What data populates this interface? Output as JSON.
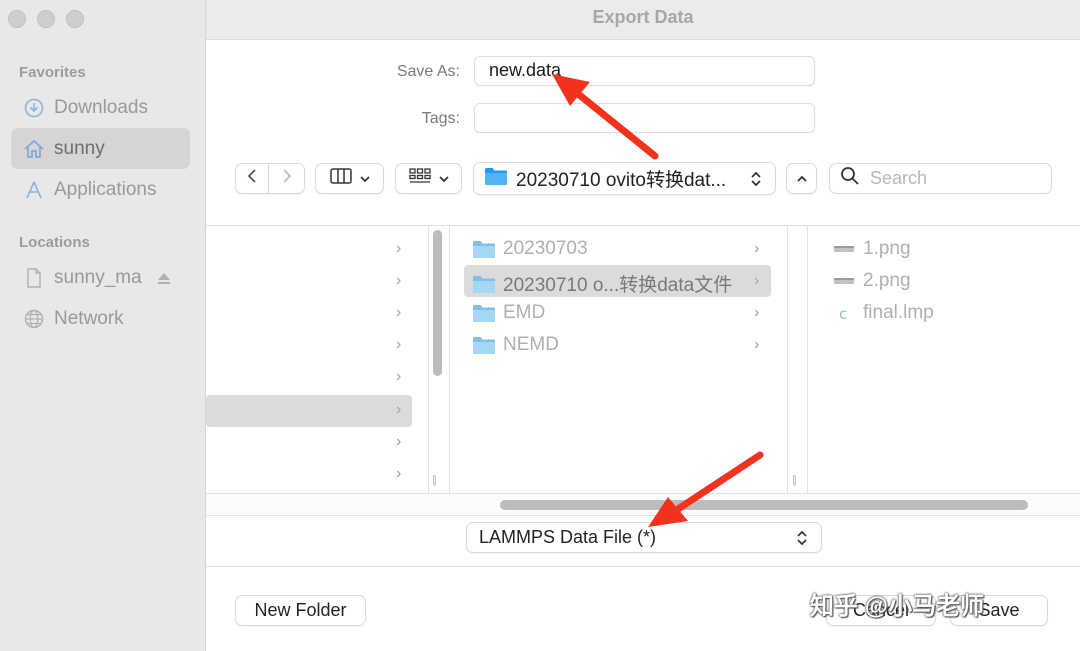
{
  "window": {
    "title": "Export Data"
  },
  "sidebar": {
    "favorites_heading": "Favorites",
    "favorites": [
      {
        "label": "Downloads",
        "icon": "download-icon"
      },
      {
        "label": "sunny",
        "icon": "home-icon",
        "selected": true
      },
      {
        "label": "Applications",
        "icon": "applications-icon"
      }
    ],
    "locations_heading": "Locations",
    "locations": [
      {
        "label": "sunny_ma",
        "icon": "document-icon"
      },
      {
        "label": "Network",
        "icon": "network-icon"
      }
    ]
  },
  "form": {
    "save_as_label": "Save As:",
    "save_as_value": "new.data",
    "tags_label": "Tags:",
    "tags_value": ""
  },
  "toolbar": {
    "path": "20230710 ovito转换dat...",
    "search_placeholder": "Search"
  },
  "browser": {
    "column2": [
      {
        "label": "20230703"
      },
      {
        "label": "20230710 o...转换data文件",
        "selected": true
      },
      {
        "label": "EMD"
      },
      {
        "label": "NEMD"
      }
    ],
    "column3": [
      {
        "label": "1.png",
        "icon": "image-file-icon"
      },
      {
        "label": "2.png",
        "icon": "image-file-icon"
      },
      {
        "label": "final.lmp",
        "icon": "code-file-icon"
      }
    ]
  },
  "format": {
    "selected": "LAMMPS Data File (*)"
  },
  "buttons": {
    "new_folder": "New Folder",
    "cancel": "Cancel",
    "save": "Save"
  },
  "watermark": {
    "text": "知乎 @小马老师"
  },
  "colors": {
    "sidebar_bg": "#e9e7e8",
    "selection_bg": "#dcdada",
    "folder_blue": "#8dc7ee",
    "arrow_red": "#f0321e"
  }
}
